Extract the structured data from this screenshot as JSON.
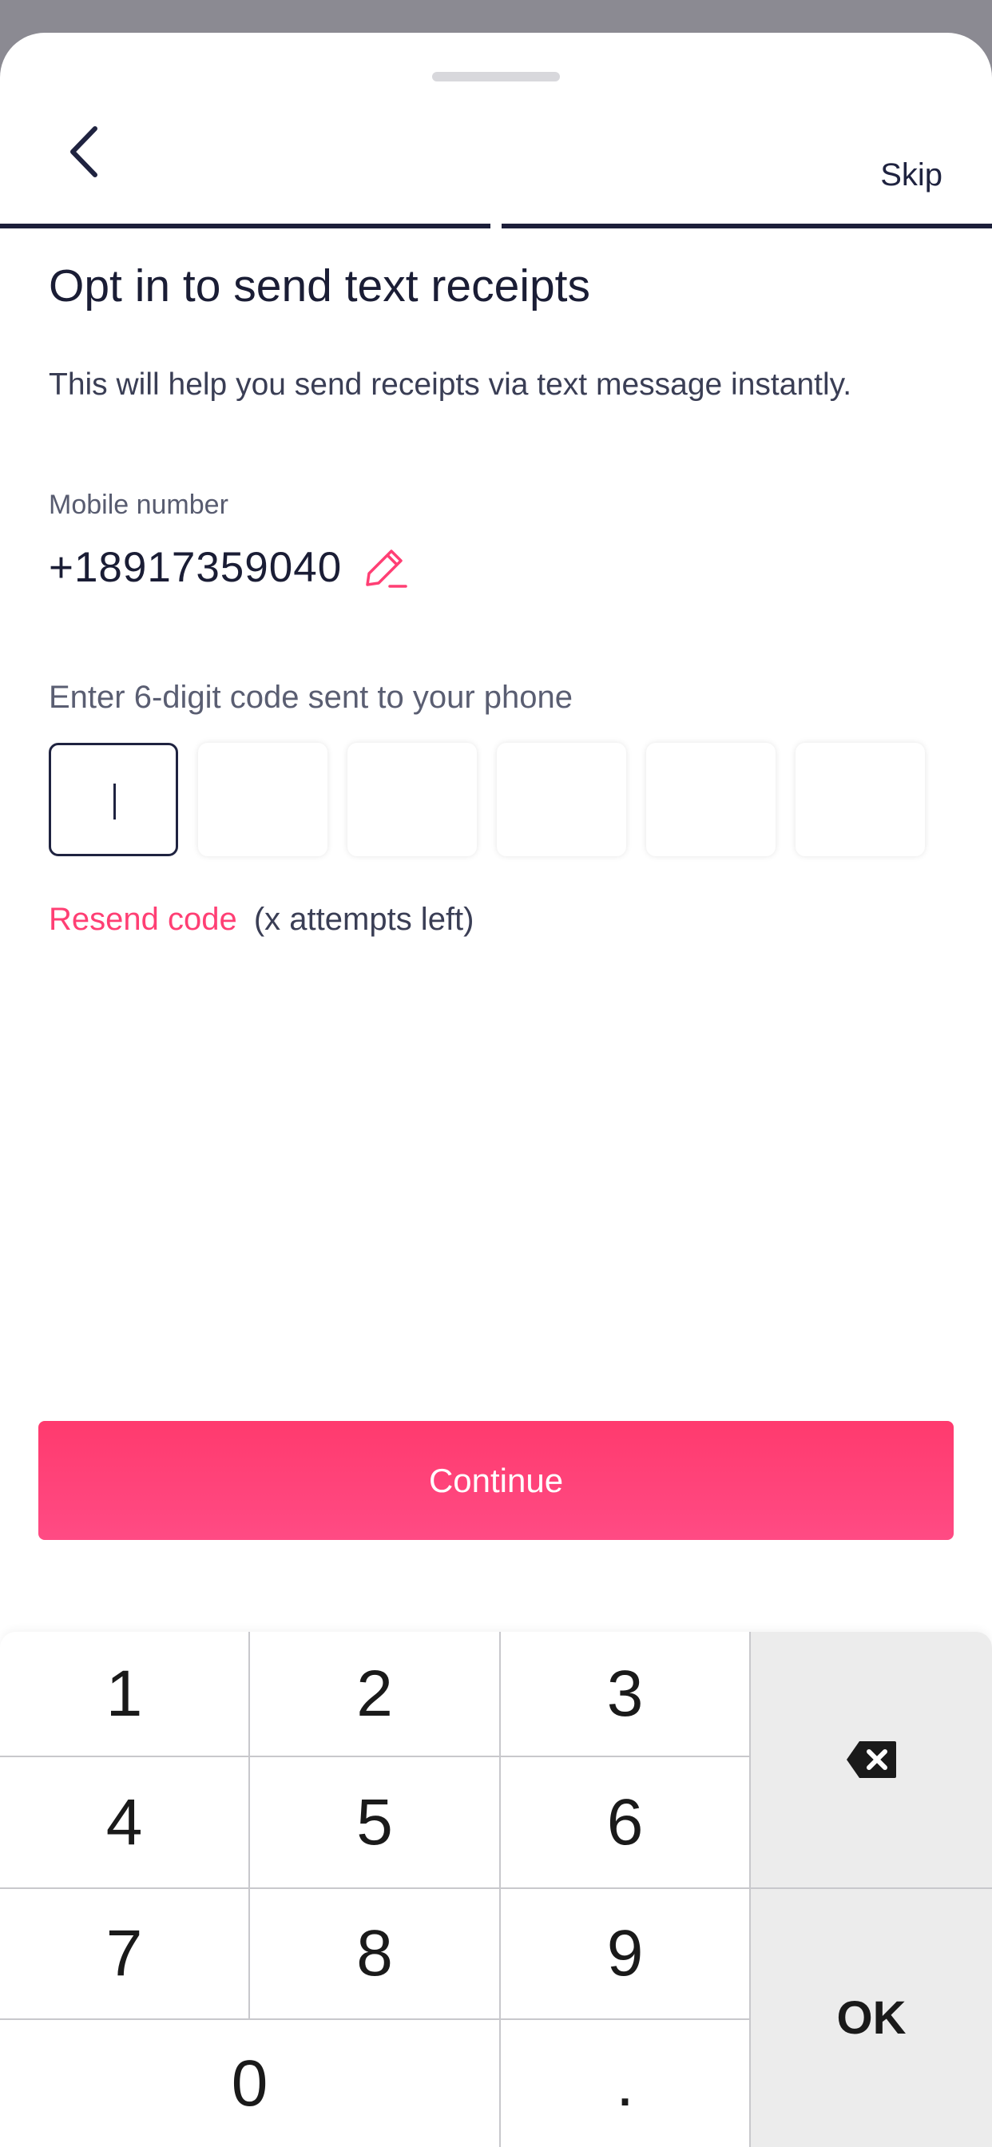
{
  "header": {
    "skip_label": "Skip",
    "progress_steps": 2,
    "progress_active": 2
  },
  "content": {
    "title": "Opt in to send text receipts",
    "subtitle": "This will help you send receipts via text message instantly.",
    "mobile_label": "Mobile number",
    "phone_number": "+18917359040",
    "code_label": "Enter 6-digit code sent to your phone",
    "otp_values": [
      "",
      "",
      "",
      "",
      "",
      ""
    ],
    "resend_label": "Resend code",
    "attempts_text": "(x attempts left)"
  },
  "actions": {
    "continue_label": "Continue"
  },
  "keypad": {
    "keys": [
      "1",
      "2",
      "3",
      "4",
      "5",
      "6",
      "7",
      "8",
      "9",
      "0",
      "."
    ],
    "ok_label": "OK",
    "delete_icon": "backspace-icon"
  },
  "colors": {
    "accent": "#ff3f74",
    "text_primary": "#1a1d35",
    "progress": "#1c1f3a"
  }
}
